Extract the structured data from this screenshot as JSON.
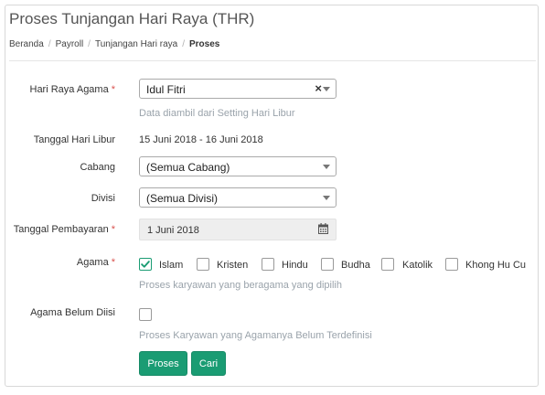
{
  "page": {
    "title": "Proses Tunjangan Hari Raya (THR)",
    "breadcrumb": [
      "Beranda",
      "Payroll",
      "Tunjangan Hari raya",
      "Proses"
    ]
  },
  "form": {
    "hari_raya": {
      "label": "Hari Raya Agama",
      "required_mark": "*",
      "value": "Idul Fitri",
      "clear_symbol": "×",
      "help": "Data diambil dari Setting Hari Libur"
    },
    "tanggal_libur": {
      "label": "Tanggal Hari Libur",
      "value": "15 Juni 2018 - 16 Juni 2018"
    },
    "cabang": {
      "label": "Cabang",
      "value": "(Semua Cabang)"
    },
    "divisi": {
      "label": "Divisi",
      "value": "(Semua Divisi)"
    },
    "tanggal_pembayaran": {
      "label": "Tanggal Pembayaran",
      "required_mark": "*",
      "value": "1 Juni 2018",
      "icon": "calendar-icon"
    },
    "agama": {
      "label": "Agama",
      "required_mark": "*",
      "options": [
        {
          "label": "Islam",
          "checked": true
        },
        {
          "label": "Kristen",
          "checked": false
        },
        {
          "label": "Hindu",
          "checked": false
        },
        {
          "label": "Budha",
          "checked": false
        },
        {
          "label": "Katolik",
          "checked": false
        },
        {
          "label": "Khong Hu Cu",
          "checked": false
        }
      ],
      "help": "Proses karyawan yang beragama yang dipilih"
    },
    "agama_belum_diisi": {
      "label": "Agama Belum Diisi",
      "checked": false,
      "help": "Proses Karyawan yang Agamanya Belum Terdefinisi"
    }
  },
  "actions": {
    "proses_label": "Proses",
    "cari_label": "Cari"
  },
  "colors": {
    "accent": "#1a9c73",
    "required": "#d9534f",
    "help_text": "#9aa3ab"
  }
}
